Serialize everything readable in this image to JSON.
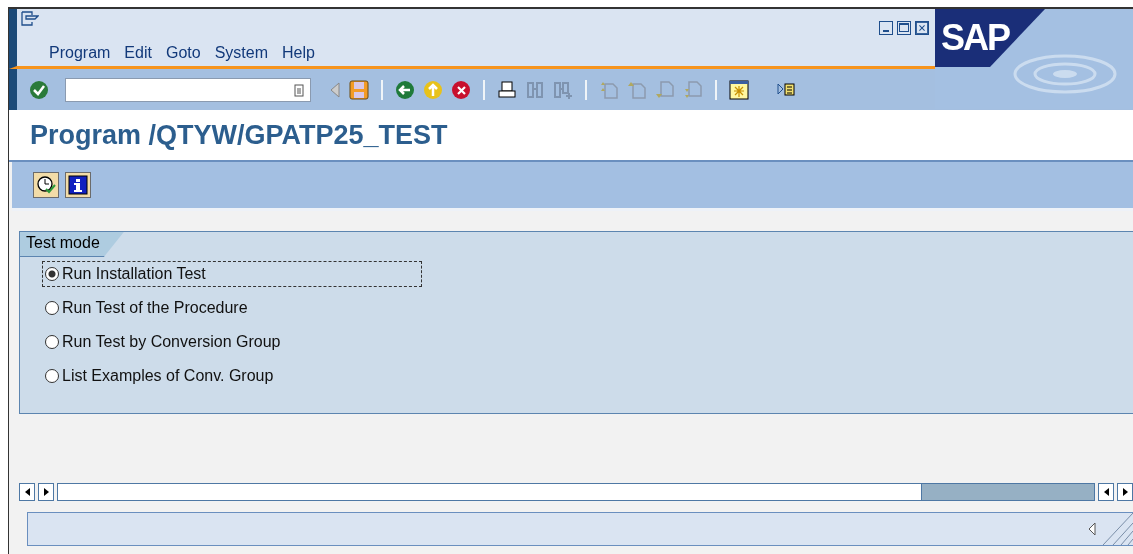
{
  "menu": [
    "Program",
    "Edit",
    "Goto",
    "System",
    "Help"
  ],
  "logo": "SAP",
  "title": "Program /QTYW/GPATP25_TEST",
  "group": {
    "title": "Test mode",
    "options": [
      {
        "label": "Run Installation Test",
        "selected": true,
        "focused": true
      },
      {
        "label": "Run Test of the Procedure",
        "selected": false,
        "focused": false
      },
      {
        "label": "Run Test by Conversion Group",
        "selected": false,
        "focused": false
      },
      {
        "label": "List Examples of Conv. Group",
        "selected": false,
        "focused": false
      }
    ]
  }
}
